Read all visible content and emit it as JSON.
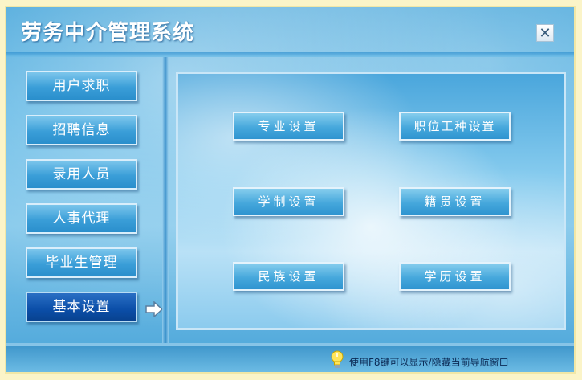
{
  "window": {
    "title": "劳务中介管理系统",
    "close_symbol": "✕"
  },
  "sidebar": {
    "items": [
      {
        "label": "用户求职"
      },
      {
        "label": "招聘信息"
      },
      {
        "label": "录用人员"
      },
      {
        "label": "人事代理"
      },
      {
        "label": "毕业生管理"
      },
      {
        "label": "基本设置"
      }
    ],
    "active_index": 5
  },
  "main": {
    "buttons": [
      {
        "label": "专业设置"
      },
      {
        "label": "职位工种设置"
      },
      {
        "label": "学制设置"
      },
      {
        "label": "籍贯设置"
      },
      {
        "label": "民族设置"
      },
      {
        "label": "学历设置"
      }
    ]
  },
  "footer": {
    "hint": "使用F8键可以显示/隐藏当前导航窗口",
    "hint_icon": "lightbulb-icon"
  },
  "colors": {
    "accent": "#2a8fcc",
    "active": "#0b4ea8",
    "background": "#fbf4c8"
  }
}
